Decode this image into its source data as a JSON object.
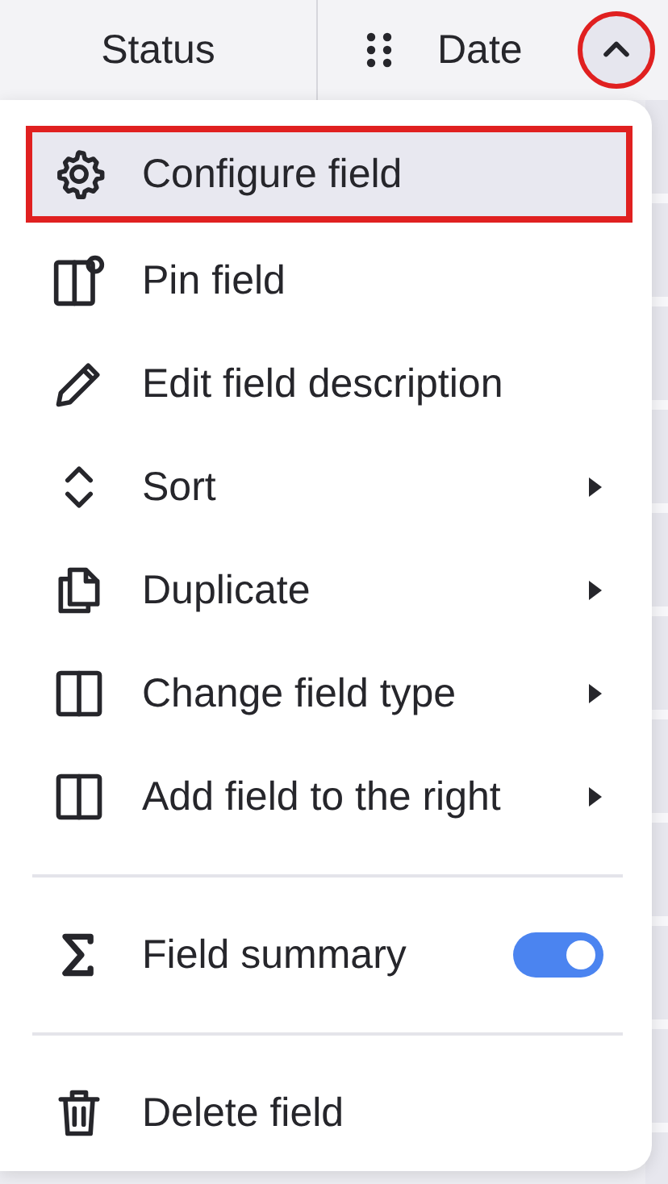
{
  "header": {
    "columns": [
      {
        "label": "Status",
        "kind": "plain"
      },
      {
        "label": "Date",
        "kind": "menu",
        "expanded": true
      }
    ]
  },
  "menu": {
    "items": [
      {
        "kind": "action",
        "label": "Configure field",
        "selected": true
      },
      {
        "kind": "action",
        "label": "Pin field",
        "selected": false
      },
      {
        "kind": "action",
        "label": "Edit field description",
        "selected": false
      },
      {
        "kind": "submenu",
        "label": "Sort",
        "selected": false
      },
      {
        "kind": "submenu",
        "label": "Duplicate",
        "selected": false
      },
      {
        "kind": "submenu",
        "label": "Change field type",
        "selected": false
      },
      {
        "kind": "submenu",
        "label": "Add field to the right",
        "selected": false
      },
      {
        "kind": "divider"
      },
      {
        "kind": "toggle",
        "label": "Field summary",
        "on": true,
        "selected": false
      },
      {
        "kind": "divider"
      },
      {
        "kind": "action",
        "label": "Delete field",
        "selected": false
      }
    ]
  }
}
